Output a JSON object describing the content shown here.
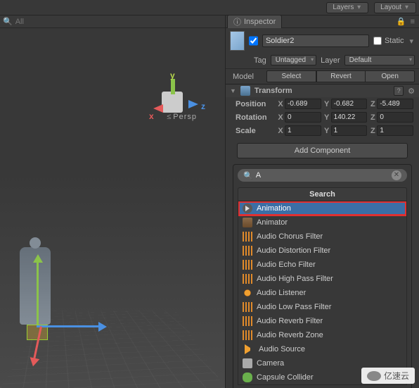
{
  "topbar": {
    "layers": "Layers",
    "layout": "Layout"
  },
  "hierarchy": {
    "search_placeholder": "All"
  },
  "viewport": {
    "persp": "Persp",
    "axes": {
      "x": "x",
      "y": "y",
      "z": "z"
    }
  },
  "inspector": {
    "tab": "Inspector",
    "object_name": "Soldier2",
    "static_label": "Static",
    "tag_label": "Tag",
    "tag_value": "Untagged",
    "layer_label": "Layer",
    "layer_value": "Default",
    "model_label": "Model",
    "select_btn": "Select",
    "revert_btn": "Revert",
    "open_btn": "Open",
    "transform": {
      "title": "Transform",
      "position_label": "Position",
      "rotation_label": "Rotation",
      "scale_label": "Scale",
      "axis_x": "X",
      "axis_y": "Y",
      "axis_z": "Z",
      "position": {
        "x": "-0.689",
        "y": "-0.682",
        "z": "-5.489"
      },
      "rotation": {
        "x": "0",
        "y": "140.22",
        "z": "0"
      },
      "scale": {
        "x": "1",
        "y": "1",
        "z": "1"
      }
    },
    "add_component": "Add Component"
  },
  "popup": {
    "search_value": "A",
    "title": "Search",
    "items": [
      {
        "label": "Animation",
        "icon": "ic-anim",
        "selected": true,
        "highlighted": true
      },
      {
        "label": "Animator",
        "icon": "ic-animator"
      },
      {
        "label": "Audio Chorus Filter",
        "icon": "ic-audio-orange"
      },
      {
        "label": "Audio Distortion Filter",
        "icon": "ic-audio-orange"
      },
      {
        "label": "Audio Echo Filter",
        "icon": "ic-audio-orange"
      },
      {
        "label": "Audio High Pass Filter",
        "icon": "ic-audio-orange"
      },
      {
        "label": "Audio Listener",
        "icon": "ic-audio-listener"
      },
      {
        "label": "Audio Low Pass Filter",
        "icon": "ic-audio-orange"
      },
      {
        "label": "Audio Reverb Filter",
        "icon": "ic-audio-orange"
      },
      {
        "label": "Audio Reverb Zone",
        "icon": "ic-audio-orange"
      },
      {
        "label": "Audio Source",
        "icon": "ic-audio-source"
      },
      {
        "label": "Camera",
        "icon": "ic-camera"
      },
      {
        "label": "Capsule Collider",
        "icon": "ic-capsule"
      }
    ]
  },
  "watermark": "亿速云"
}
